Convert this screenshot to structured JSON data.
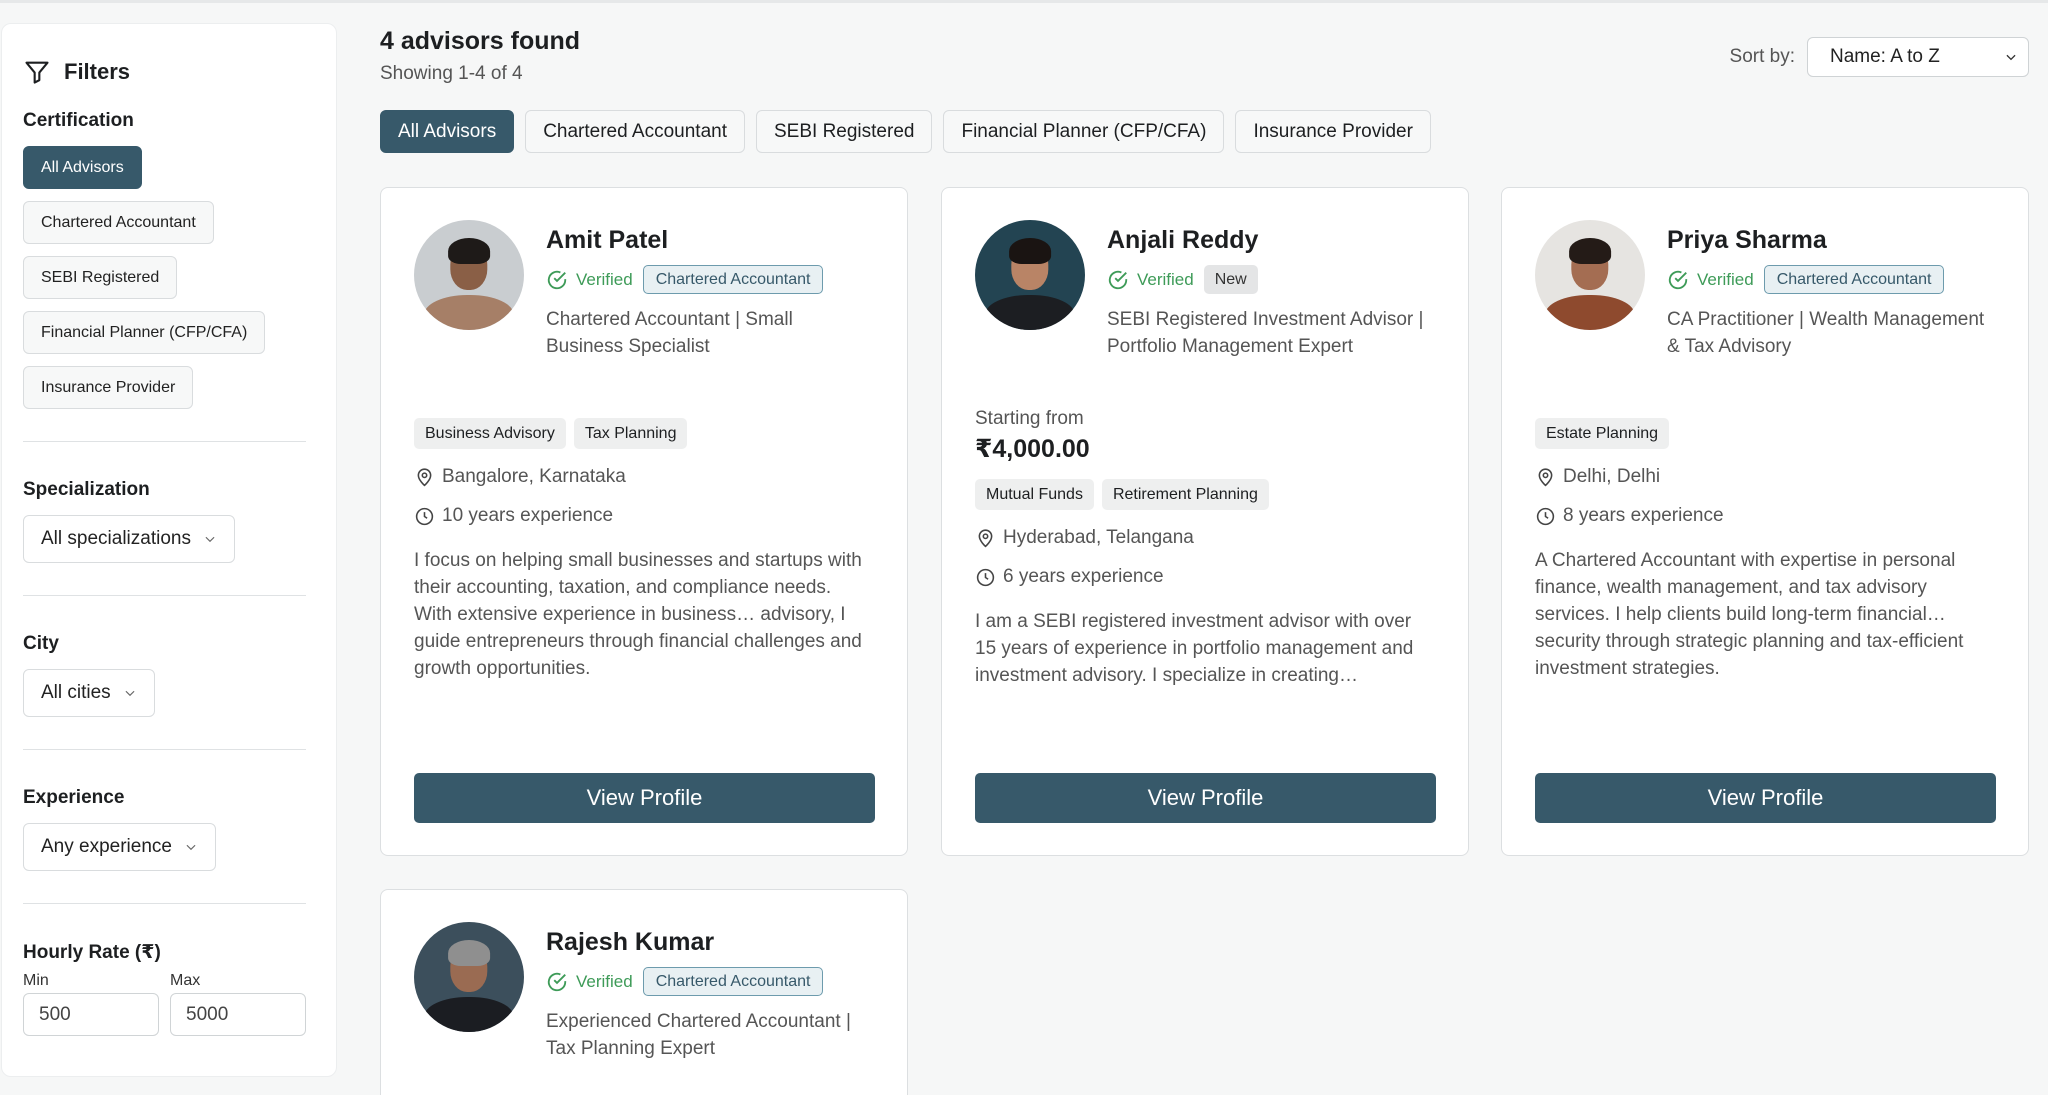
{
  "sidebar": {
    "title": "Filters",
    "certification": {
      "title": "Certification",
      "options": [
        "All Advisors",
        "Chartered Accountant",
        "SEBI Registered",
        "Financial Planner (CFP/CFA)",
        "Insurance Provider"
      ],
      "active": "All Advisors"
    },
    "specialization": {
      "title": "Specialization",
      "value": "All specializations"
    },
    "city": {
      "title": "City",
      "value": "All cities"
    },
    "experience": {
      "title": "Experience",
      "value": "Any experience"
    },
    "rate": {
      "title": "Hourly Rate (₹)",
      "min_label": "Min",
      "max_label": "Max",
      "min_value": "500",
      "max_value": "5000"
    }
  },
  "header": {
    "found": "4 advisors found",
    "showing": "Showing 1-4 of 4",
    "sort_label": "Sort by:",
    "sort_value": "Name: A to Z"
  },
  "tabs": [
    "All Advisors",
    "Chartered Accountant",
    "SEBI Registered",
    "Financial Planner (CFP/CFA)",
    "Insurance Provider"
  ],
  "verified_label": "Verified",
  "button_label": "View Profile",
  "advisors": [
    {
      "name": "Amit Patel",
      "badge": "Chartered Accountant",
      "tagline": "Chartered Accountant | Small Business Specialist",
      "tags": [
        "Business Advisory",
        "Tax Planning"
      ],
      "location": "Bangalore, Karnataka",
      "experience": "10 years experience",
      "description": "I focus on helping small businesses and startups with their accounting, taxation, and compliance needs. With extensive experience in business… advisory, I guide entrepreneurs through financial challenges and growth opportunities."
    },
    {
      "name": "Anjali Reddy",
      "badge": "New",
      "tagline": "SEBI Registered Investment Advisor | Portfolio Management Expert",
      "price_label": "Starting from",
      "price": "₹4,000.00",
      "tags": [
        "Mutual Funds",
        "Retirement Planning"
      ],
      "location": "Hyderabad, Telangana",
      "experience": "6 years experience",
      "description": "I am a SEBI registered investment advisor with over 15 years of experience in portfolio management and investment advisory. I specialize in creating…"
    },
    {
      "name": "Priya Sharma",
      "badge": "Chartered Accountant",
      "tagline": "CA Practitioner | Wealth Management & Tax Advisory",
      "tags": [
        "Estate Planning"
      ],
      "location": "Delhi, Delhi",
      "experience": "8 years experience",
      "description": "A Chartered Accountant with expertise in personal finance, wealth management, and tax advisory services. I help clients build long-term financial… security through strategic planning and tax-efficient investment strategies."
    },
    {
      "name": "Rajesh Kumar",
      "badge": "Chartered Accountant",
      "tagline": "Experienced Chartered Accountant | Tax Planning Expert"
    }
  ],
  "colors": {
    "accent": "#37596a",
    "verified": "#3e9b58"
  }
}
